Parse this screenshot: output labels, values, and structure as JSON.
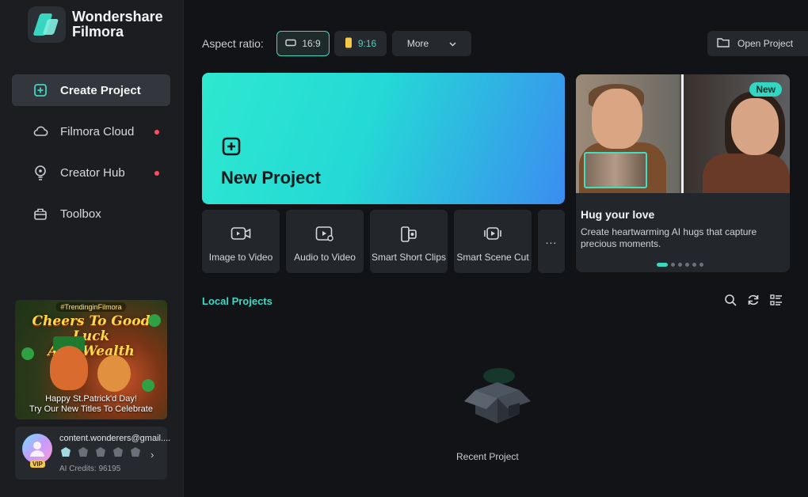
{
  "app": {
    "title_line1": "Wondershare",
    "title_line2": "Filmora"
  },
  "sidebar": {
    "items": [
      {
        "label": "Create Project",
        "icon": "plus-square-icon",
        "active": true,
        "dot": false
      },
      {
        "label": "Filmora Cloud",
        "icon": "cloud-icon",
        "active": false,
        "dot": true
      },
      {
        "label": "Creator Hub",
        "icon": "bulb-icon",
        "active": false,
        "dot": true
      },
      {
        "label": "Toolbox",
        "icon": "toolbox-icon",
        "active": false,
        "dot": false
      }
    ],
    "banner": {
      "tag": "#TrendinginFilmora",
      "headline_line1": "Cheers To Good Luck",
      "headline_line2": "And Wealth",
      "sub_line1": "Happy St.Patrick'd Day!",
      "sub_line2": "Try Our New Titles To Celebrate"
    },
    "account": {
      "email": "content.wonderers@gmail....",
      "vip": "VIP",
      "credits": "AI Credits: 96195"
    }
  },
  "toolbar": {
    "aspect_label": "Aspect ratio:",
    "ratio_169": "16:9",
    "ratio_916": "9:16",
    "more_label": "More",
    "open_project": "Open Project"
  },
  "new_project": {
    "label": "New Project"
  },
  "tools": [
    {
      "label": "Image to Video",
      "icon": "image-to-video-icon"
    },
    {
      "label": "Audio to Video",
      "icon": "audio-to-video-icon"
    },
    {
      "label": "Smart Short Clips",
      "icon": "smart-short-clips-icon"
    },
    {
      "label": "Smart Scene Cut",
      "icon": "smart-scene-cut-icon"
    },
    {
      "label": "...",
      "icon": "more-dots-icon"
    }
  ],
  "promo": {
    "badge": "New",
    "title": "Hug your love",
    "description": "Create heartwarming AI hugs that capture precious moments."
  },
  "local_projects": {
    "title": "Local Projects",
    "empty_label": "Recent Project"
  },
  "colors": {
    "accent": "#3fd6c0",
    "sidebar_bg": "#1b1d21",
    "main_bg": "#111316",
    "notify_dot": "#ff4d5e"
  }
}
